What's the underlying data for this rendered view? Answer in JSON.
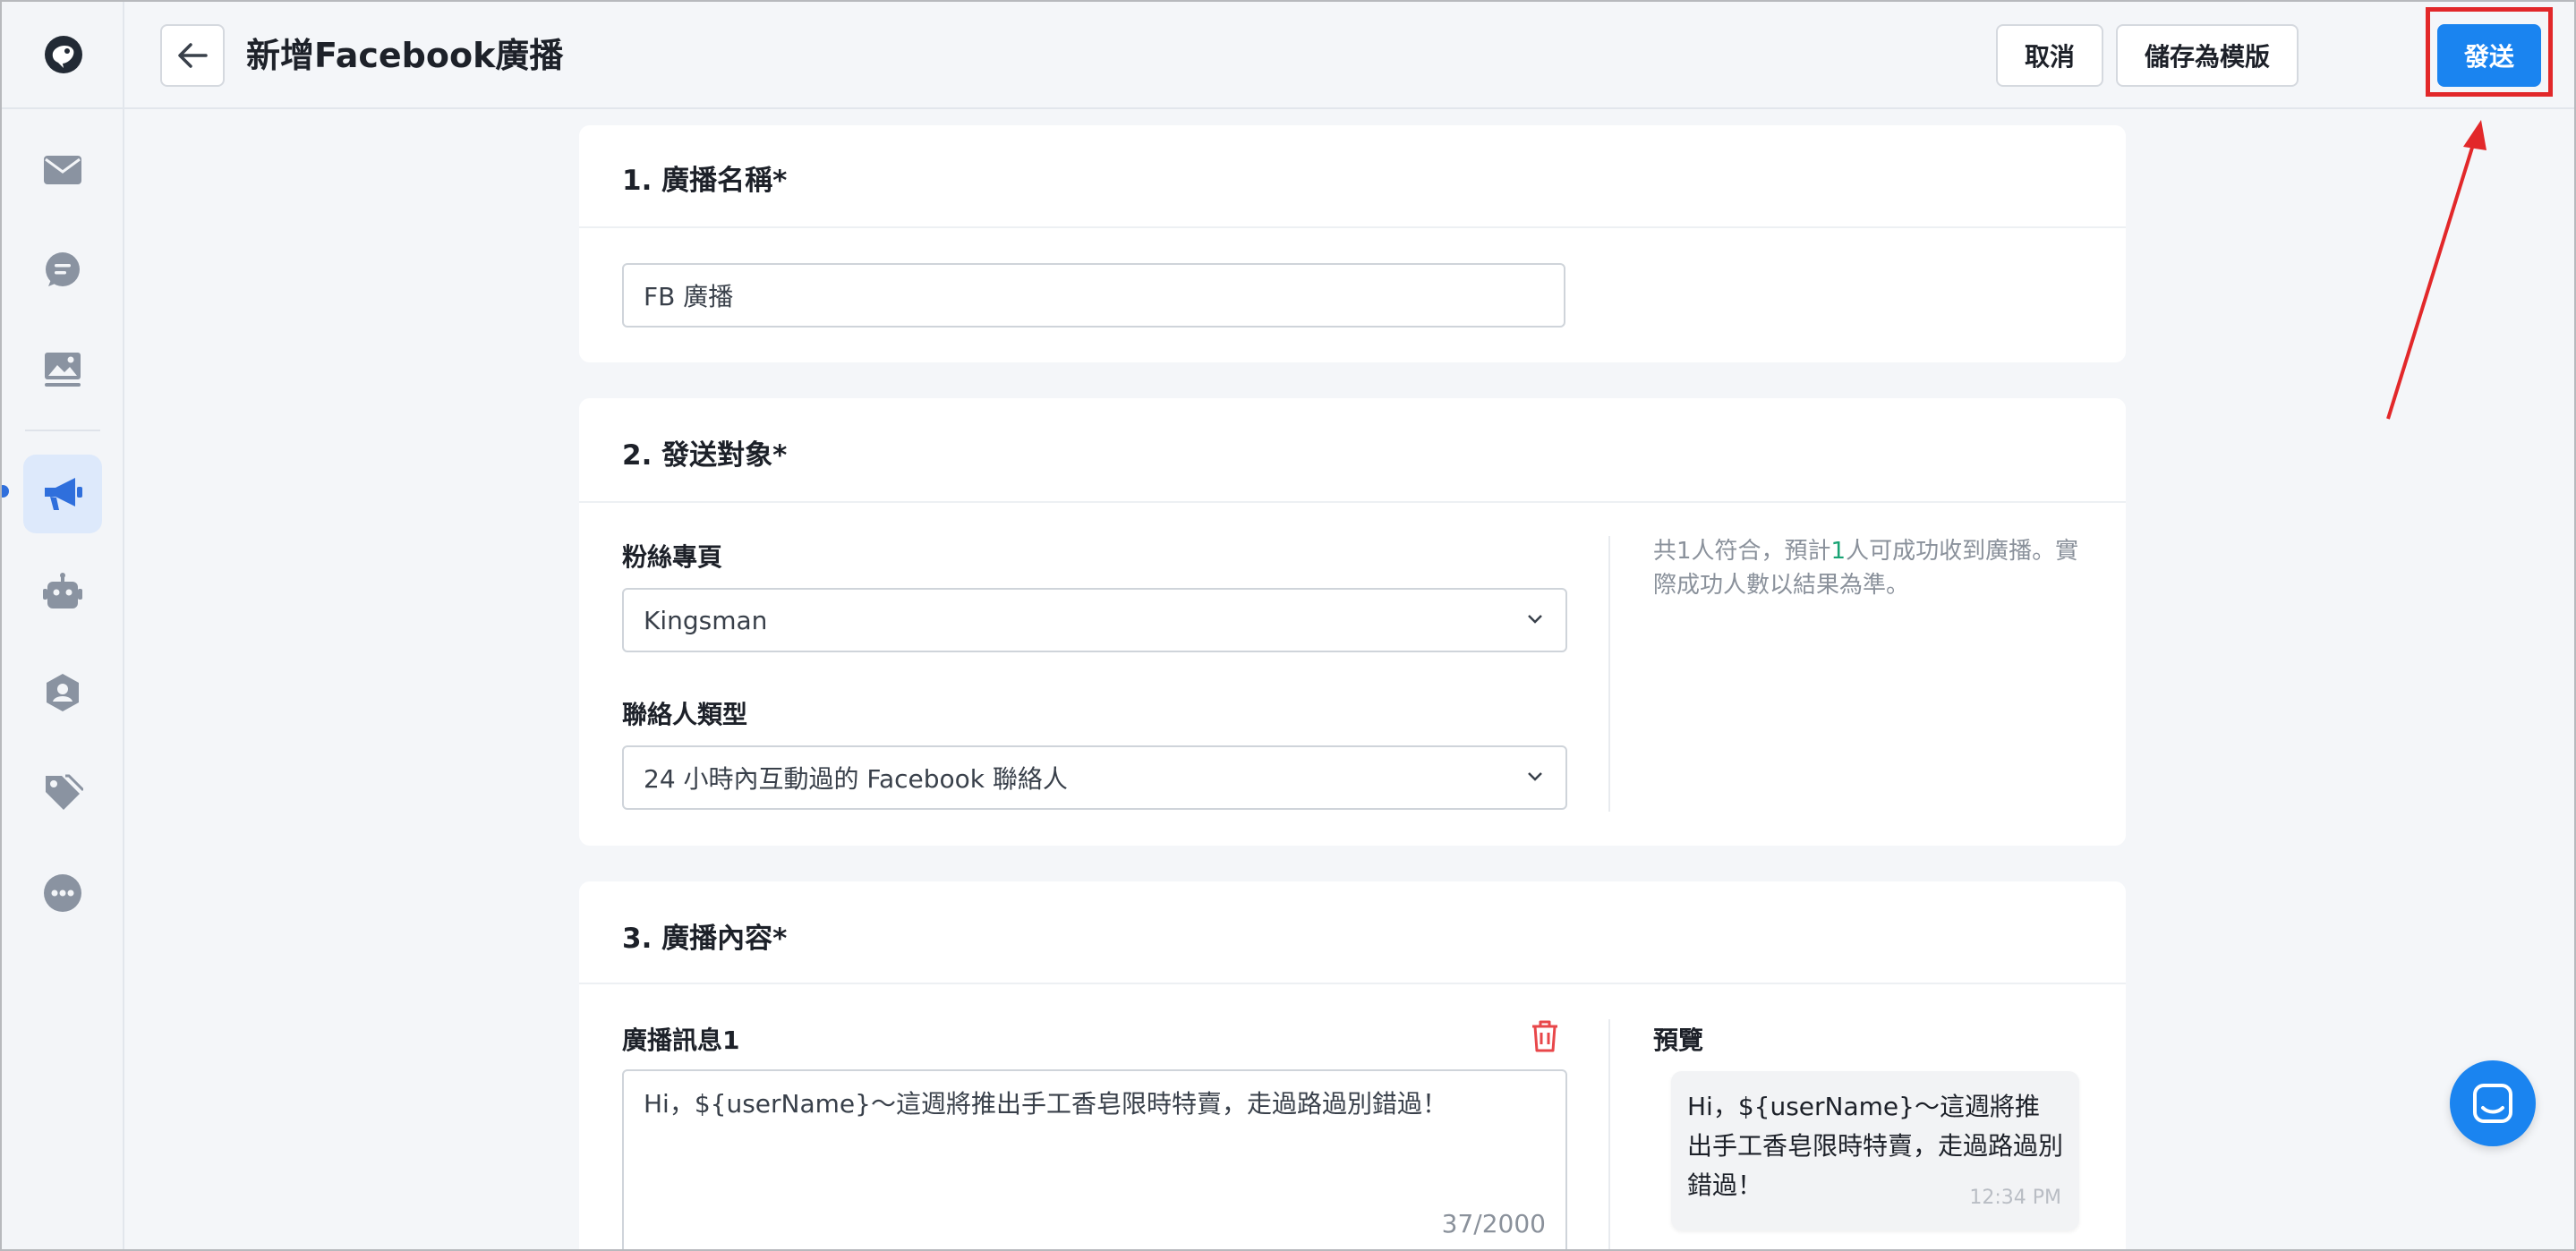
{
  "header": {
    "title": "新增Facebook廣播",
    "cancel_label": "取消",
    "save_template_label": "儲存為模版",
    "send_label": "發送"
  },
  "sidebar": {
    "items": [
      {
        "icon": "logo-icon"
      },
      {
        "icon": "inbox-icon"
      },
      {
        "icon": "chat-icon"
      },
      {
        "icon": "image-library-icon"
      },
      {
        "icon": "broadcast-megaphone-icon",
        "active": true
      },
      {
        "icon": "bot-icon"
      },
      {
        "icon": "contacts-shield-icon"
      },
      {
        "icon": "tags-icon"
      },
      {
        "icon": "more-icon"
      }
    ]
  },
  "section1": {
    "title": "1. 廣播名稱*",
    "name_value": "FB 廣播"
  },
  "section2": {
    "title": "2. 發送對象*",
    "page_label": "粉絲專頁",
    "page_value": "Kingsman",
    "contact_type_label": "聯絡人類型",
    "contact_type_value": "24 小時內互動過的 Facebook 聯絡人",
    "hint_prefix": "共1人符合，預計",
    "hint_num": "1",
    "hint_suffix": "人可成功收到廣播。實際成功人數以結果為準。"
  },
  "section3": {
    "title": "3. 廣播內容*",
    "message_label": "廣播訊息1",
    "message_value": "Hi，${userName}～這週將推出手工香皂限時特賣，走過路過別錯過！",
    "char_count": "37/2000",
    "preview_label": "預覽",
    "preview_text": "Hi，${userName}～這週將推出手工香皂限時特賣，走過路過別錯過！",
    "preview_time": "12:34 PM"
  },
  "colors": {
    "primary": "#1a84f0",
    "highlight_box": "#e2282a",
    "hint_number": "#19a374",
    "delete_icon": "#e8474a"
  }
}
